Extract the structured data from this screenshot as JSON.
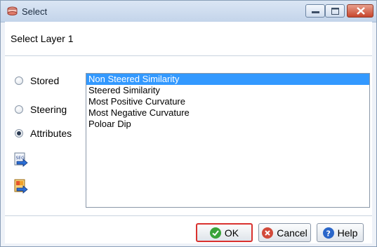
{
  "window": {
    "title": "Select",
    "controls": [
      "minimize-icon",
      "maximize-icon",
      "close-icon"
    ]
  },
  "dialog": {
    "layer_label": "Select Layer 1",
    "options": [
      {
        "label": "Stored",
        "checked": false
      },
      {
        "label": "Steering",
        "checked": false
      },
      {
        "label": "Attributes",
        "checked": true
      }
    ],
    "attribute_list": [
      {
        "label": "Non Steered Similarity",
        "selected": true
      },
      {
        "label": "Steered Similarity",
        "selected": false
      },
      {
        "label": "Most Positive Curvature",
        "selected": false
      },
      {
        "label": "Most Negative Curvature",
        "selected": false
      },
      {
        "label": "Poloar Dip",
        "selected": false
      }
    ],
    "side_icons": [
      "seg-file-import-icon",
      "color-file-import-icon"
    ]
  },
  "buttons": {
    "ok": "OK",
    "cancel": "Cancel",
    "help": "Help"
  },
  "colors": {
    "selection": "#3399ff",
    "ok_highlight": "#d9322f",
    "ok_icon": "#3aa33a",
    "cancel_icon": "#d24a3a",
    "help_icon": "#2a66c9"
  }
}
